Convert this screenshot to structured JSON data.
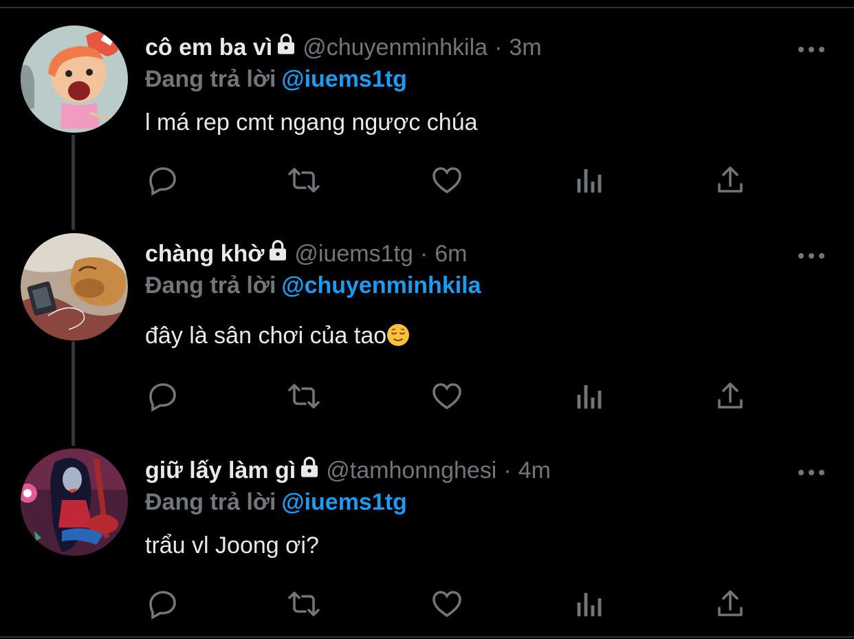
{
  "tweets": [
    {
      "display_name": "cô em ba vì",
      "handle": "@chuyenminhkila",
      "separator": "·",
      "time": "3m",
      "replying_label": "Đang trả lời",
      "replying_to": "@iuems1tg",
      "text": "l má rep cmt ngang ngược chúa",
      "avatar_icon": "cartoon-girl-avatar"
    },
    {
      "display_name": "chàng khờ",
      "handle": "@iuems1tg",
      "separator": "·",
      "time": "6m",
      "replying_label": "Đang trả lời",
      "replying_to": "@chuyenminhkila",
      "text": "đây là sân chơi của tao",
      "emoji": "relieved-face-emoji",
      "avatar_icon": "sleeping-dog-avatar"
    },
    {
      "display_name": "giữ lấy làm gì",
      "handle": "@tamhonnghesi",
      "separator": "·",
      "time": "4m",
      "replying_label": "Đang trả lời",
      "replying_to": "@iuems1tg",
      "text": "trẩu vl Joong ơi?",
      "avatar_icon": "marceline-avatar"
    }
  ],
  "colors": {
    "background": "#000000",
    "primary_text": "#e7e9ea",
    "secondary_text": "#71767b",
    "accent": "#1d9bf0"
  },
  "icons": [
    "lock-icon",
    "more-icon",
    "reply-icon",
    "retweet-icon",
    "like-icon",
    "analytics-icon",
    "share-icon"
  ]
}
